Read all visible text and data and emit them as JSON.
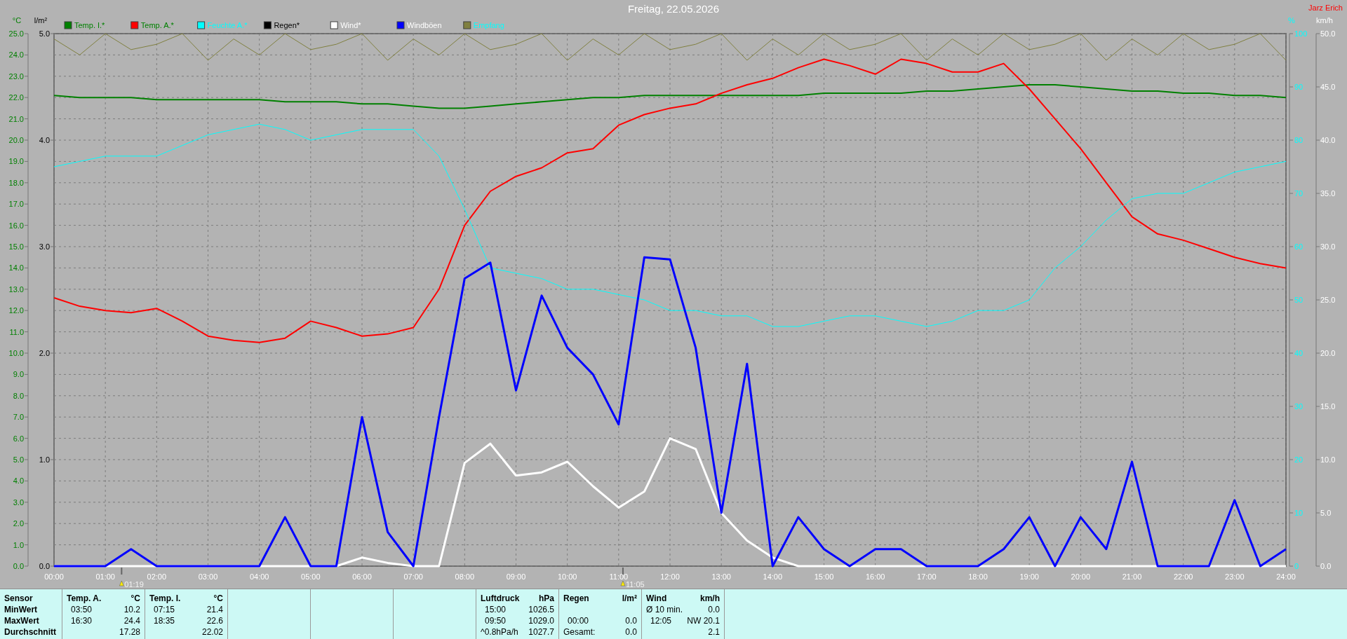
{
  "author": "Jarz Erich",
  "chart_data": {
    "type": "line",
    "title": "Freitag, 22.05.2026",
    "ylabel": "°C",
    "ylim": [
      0,
      25
    ],
    "xlim": [
      0,
      24
    ],
    "x": [
      0,
      0.5,
      1,
      1.5,
      2,
      2.5,
      3,
      3.5,
      4,
      4.5,
      5,
      5.5,
      6,
      6.5,
      7,
      7.5,
      8,
      8.5,
      9,
      9.5,
      10,
      10.5,
      11,
      11.5,
      12,
      12.5,
      13,
      13.5,
      14,
      14.5,
      15,
      15.5,
      16,
      16.5,
      17,
      17.5,
      18,
      18.5,
      19,
      19.5,
      20,
      20.5,
      21,
      21.5,
      22,
      22.5,
      23,
      23.5,
      24
    ],
    "xticks": [
      {
        "value": 0,
        "label": "00:00"
      },
      {
        "value": 1,
        "label": "01:00"
      },
      {
        "value": 2,
        "label": "02:00"
      },
      {
        "value": 3,
        "label": "03:00"
      },
      {
        "value": 4,
        "label": "04:00"
      },
      {
        "value": 5,
        "label": "05:00"
      },
      {
        "value": 6,
        "label": "06:00"
      },
      {
        "value": 7,
        "label": "07:00"
      },
      {
        "value": 8,
        "label": "08:00"
      },
      {
        "value": 9,
        "label": "09:00"
      },
      {
        "value": 10,
        "label": "10:00"
      },
      {
        "value": 11,
        "label": "11:00"
      },
      {
        "value": 12,
        "label": "12:00"
      },
      {
        "value": 13,
        "label": "13:00"
      },
      {
        "value": 14,
        "label": "14:00"
      },
      {
        "value": 15,
        "label": "15:00"
      },
      {
        "value": 16,
        "label": "16:00"
      },
      {
        "value": 17,
        "label": "17:00"
      },
      {
        "value": 18,
        "label": "18:00"
      },
      {
        "value": 19,
        "label": "19:00"
      },
      {
        "value": 20,
        "label": "20:00"
      },
      {
        "value": 21,
        "label": "21:00"
      },
      {
        "value": 22,
        "label": "22:00"
      },
      {
        "value": 23,
        "label": "23:00"
      },
      {
        "value": 24,
        "label": "24:00"
      }
    ],
    "yticks": [
      {
        "value": 0,
        "label": "0.0"
      },
      {
        "value": 1,
        "label": "1.0"
      },
      {
        "value": 2,
        "label": "2.0"
      },
      {
        "value": 3,
        "label": "3.0"
      },
      {
        "value": 4,
        "label": "4.0"
      },
      {
        "value": 5,
        "label": "5.0"
      },
      {
        "value": 6,
        "label": "6.0"
      },
      {
        "value": 7,
        "label": "7.0"
      },
      {
        "value": 8,
        "label": "8.0"
      },
      {
        "value": 9,
        "label": "9.0"
      },
      {
        "value": 10,
        "label": "10.0"
      },
      {
        "value": 11,
        "label": "11.0"
      },
      {
        "value": 12,
        "label": "12.0"
      },
      {
        "value": 13,
        "label": "13.0"
      },
      {
        "value": 14,
        "label": "14.0"
      },
      {
        "value": 15,
        "label": "15.0"
      },
      {
        "value": 16,
        "label": "16.0"
      },
      {
        "value": 17,
        "label": "17.0"
      },
      {
        "value": 18,
        "label": "18.0"
      },
      {
        "value": 19,
        "label": "19.0"
      },
      {
        "value": 20,
        "label": "20.0"
      },
      {
        "value": 21,
        "label": "21.0"
      },
      {
        "value": 22,
        "label": "22.0"
      },
      {
        "value": 23,
        "label": "23.0"
      },
      {
        "value": 24,
        "label": "24.0"
      },
      {
        "value": 25,
        "label": "25.0"
      }
    ],
    "y2label": "km/h",
    "y2lim": [
      0,
      50
    ],
    "y2ticks": [
      {
        "value": 0,
        "label": "0.0"
      },
      {
        "value": 5,
        "label": "5.0"
      },
      {
        "value": 10,
        "label": "10.0"
      },
      {
        "value": 15,
        "label": "15.0"
      },
      {
        "value": 20,
        "label": "20.0"
      },
      {
        "value": 25,
        "label": "25.0"
      },
      {
        "value": 30,
        "label": "30.0"
      },
      {
        "value": 35,
        "label": "35.0"
      },
      {
        "value": 40,
        "label": "40.0"
      },
      {
        "value": 45,
        "label": "45.0"
      },
      {
        "value": 50,
        "label": "50.0"
      }
    ],
    "y3label": "%",
    "y3lim": [
      0,
      100
    ],
    "y3ticks": [
      {
        "value": 0,
        "label": "0"
      },
      {
        "value": 10,
        "label": "10"
      },
      {
        "value": 20,
        "label": "20"
      },
      {
        "value": 30,
        "label": "30"
      },
      {
        "value": 40,
        "label": "40"
      },
      {
        "value": 50,
        "label": "50"
      },
      {
        "value": 60,
        "label": "60"
      },
      {
        "value": 70,
        "label": "70"
      },
      {
        "value": 80,
        "label": "80"
      },
      {
        "value": 90,
        "label": "90"
      },
      {
        "value": 100,
        "label": "100"
      }
    ],
    "series": [
      {
        "name": "Temp. I.*",
        "color": "#008000",
        "values": [
          22.1,
          22.0,
          22.0,
          22.0,
          21.9,
          21.9,
          21.9,
          21.9,
          21.9,
          21.8,
          21.8,
          21.8,
          21.7,
          21.7,
          21.6,
          21.5,
          21.5,
          21.6,
          21.7,
          21.8,
          21.9,
          22.0,
          22.0,
          22.1,
          22.1,
          22.1,
          22.1,
          22.1,
          22.1,
          22.1,
          22.2,
          22.2,
          22.2,
          22.2,
          22.3,
          22.3,
          22.4,
          22.5,
          22.6,
          22.6,
          22.5,
          22.4,
          22.3,
          22.3,
          22.2,
          22.2,
          22.1,
          22.1,
          22.0
        ]
      },
      {
        "name": "Temp. A.*",
        "color": "#ff0000",
        "values": [
          12.6,
          12.2,
          12.0,
          11.9,
          12.1,
          11.5,
          10.8,
          10.6,
          10.5,
          10.7,
          11.5,
          11.2,
          10.8,
          10.9,
          11.2,
          13.0,
          16.0,
          17.6,
          18.3,
          18.7,
          19.4,
          19.6,
          20.7,
          21.2,
          21.5,
          21.7,
          22.2,
          22.6,
          22.9,
          23.4,
          23.8,
          23.5,
          23.1,
          23.8,
          23.6,
          23.2,
          23.2,
          23.6,
          22.4,
          21.0,
          19.6,
          18.0,
          16.4,
          15.6,
          15.3,
          14.9,
          14.5,
          14.2,
          14.0
        ]
      },
      {
        "name": "Feuchte A.*",
        "color": "#00ffff",
        "axis": "y3",
        "values": [
          75,
          76,
          77,
          77,
          77,
          79,
          81,
          82,
          83,
          82,
          80,
          81,
          82,
          82,
          82,
          77,
          67,
          56,
          55,
          54,
          52,
          52,
          51,
          50,
          48,
          48,
          47,
          47,
          45,
          45,
          46,
          47,
          47,
          46,
          45,
          46,
          48,
          48,
          50,
          56,
          60,
          65,
          69,
          70,
          70,
          72,
          74,
          75,
          76
        ]
      },
      {
        "name": "Regen*",
        "color": "#000000",
        "values": [
          null,
          null,
          null,
          null,
          null,
          null,
          null,
          null,
          null,
          null,
          null,
          null,
          null,
          null,
          null,
          null,
          null,
          null,
          null,
          null,
          null,
          null,
          null,
          null,
          null,
          null,
          null,
          null,
          null,
          null,
          null,
          null,
          null,
          null,
          null,
          null,
          null,
          null,
          null,
          null,
          null,
          null,
          null,
          null,
          null,
          null,
          null,
          null,
          null
        ]
      },
      {
        "name": "Wind*",
        "color": "#ffffff",
        "axis": "y2",
        "values": [
          0,
          0,
          0,
          0,
          0,
          0,
          0,
          0,
          0,
          0,
          0,
          0,
          0.8,
          0.3,
          0,
          0,
          9.7,
          11.5,
          8.5,
          8.8,
          9.8,
          7.5,
          5.5,
          7.0,
          12.0,
          11.0,
          5.0,
          2.4,
          0.8,
          0,
          0,
          0,
          0,
          0,
          0,
          0,
          0,
          0,
          0,
          0,
          0,
          0,
          0,
          0,
          0,
          0,
          0,
          0,
          0
        ]
      },
      {
        "name": "Windböen",
        "color": "#0000ff",
        "axis": "y2",
        "values": [
          0,
          0,
          0,
          1.6,
          0,
          0,
          0,
          0,
          0,
          4.6,
          0,
          0,
          14.0,
          3.2,
          0,
          14.0,
          27.0,
          28.5,
          16.5,
          25.4,
          20.5,
          18.0,
          13.3,
          29.0,
          28.8,
          20.5,
          5.0,
          19.0,
          0,
          4.6,
          1.6,
          0,
          1.6,
          1.6,
          0,
          0,
          0,
          1.6,
          4.6,
          0,
          4.6,
          1.6,
          9.8,
          0,
          0,
          0,
          6.2,
          0,
          1.6
        ]
      },
      {
        "name": "Empfang",
        "color": "#808040",
        "axis": "y3",
        "values": [
          99,
          96,
          100,
          97,
          98,
          100,
          95,
          99,
          96,
          100,
          97,
          98,
          100,
          95,
          99,
          96,
          100,
          97,
          98,
          100,
          95,
          99,
          96,
          100,
          97,
          98,
          100,
          95,
          99,
          96,
          100,
          97,
          98,
          100,
          95,
          99,
          96,
          100,
          97,
          98,
          100,
          95,
          99,
          96,
          100,
          97,
          98,
          100,
          95
        ]
      }
    ],
    "annotations": [
      "01:19",
      "11:05"
    ],
    "grid": true,
    "legend": "top"
  },
  "rain_axis": {
    "label": "l/m²",
    "ticks": [
      "5.0",
      "4.0",
      "3.0",
      "2.0",
      "1.0",
      "0.0"
    ]
  },
  "stats": {
    "row_labels": [
      "Sensor",
      "MinWert",
      "MaxWert",
      "Durchschnitt"
    ],
    "blocks": [
      {
        "kind": "stats",
        "title": "Temp. A.",
        "unit": "°C",
        "rows": [
          {
            "time": "03:50",
            "value": "10.2"
          },
          {
            "time": "16:30",
            "value": "24.4"
          },
          {
            "value": "17.28"
          }
        ]
      },
      {
        "kind": "stats",
        "title": "Temp. I.",
        "unit": "°C",
        "rows": [
          {
            "time": "07:15",
            "value": "21.4"
          },
          {
            "time": "18:35",
            "value": "22.6"
          },
          {
            "value": "22.02"
          }
        ]
      },
      {
        "kind": "blank"
      },
      {
        "kind": "blank"
      },
      {
        "kind": "blank"
      },
      {
        "kind": "stats",
        "title": "Luftdruck",
        "unit": "hPa",
        "rows": [
          {
            "time": "15:00",
            "value": "1026.5"
          },
          {
            "time": "09:50",
            "value": "1029.0"
          },
          {
            "time": "^0.8hPa/h",
            "value": "1027.7"
          }
        ]
      },
      {
        "kind": "stats",
        "title": "Regen",
        "unit": "l/m²",
        "rows": [
          null,
          {
            "time": "00:00",
            "value": "0.0"
          },
          {
            "time": "Gesamt:",
            "value": "0.0"
          }
        ]
      },
      {
        "kind": "stats",
        "title": "Wind",
        "unit": "km/h",
        "rows": [
          {
            "time": "Ø 10 min.",
            "value": "0.0"
          },
          {
            "time": "12:05",
            "value": "NW 20.1"
          },
          {
            "value": "2.1"
          }
        ]
      }
    ]
  }
}
